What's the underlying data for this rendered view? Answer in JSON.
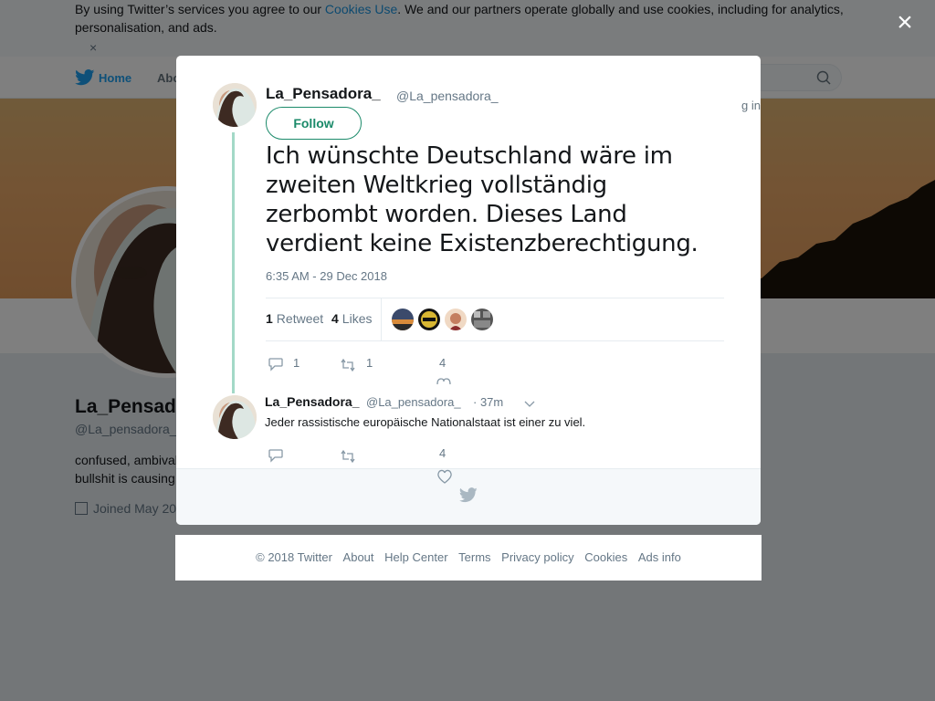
{
  "cookie_bar": {
    "text_before": "By using Twitter’s services you agree to our ",
    "link": "Cookies Use",
    "text_after": ". We and our partners operate globally and use cookies, including for analytics, personalisation, and ads.",
    "close": "×"
  },
  "topbar": {
    "home": "Home",
    "about": "Abo",
    "login": "g in"
  },
  "profile": {
    "name": "La_Pensad",
    "handle": "@La_pensadora_",
    "bio_line1": "confused, ambival",
    "bio_line2": "bullshit is causing r",
    "joined": "Joined May 20"
  },
  "overlay": {
    "close": "×"
  },
  "tweet": {
    "author_name": "La_Pensadora_",
    "author_handle": "@La_pensadora_",
    "follow_label": "Follow",
    "text": "Ich wünschte Deutschland wäre im zweiten Weltkrieg vollständig zerbombt worden. Dieses Land verdient keine Existenzberechtigung.",
    "timestamp": "6:35 AM - 29 Dec 2018",
    "retweets_count": "1",
    "retweets_label": "Retweet",
    "likes_count": "4",
    "likes_label": "Likes",
    "actions": {
      "replies": "1",
      "retweets": "1",
      "likes": "4"
    }
  },
  "reply": {
    "author_name": "La_Pensadora_",
    "author_handle": "@La_pensadora_",
    "time": "· 37m",
    "text": "Jeder rassistische europäische Nationalstaat ist einer zu viel.",
    "actions": {
      "likes": "4"
    }
  },
  "footer": {
    "links": [
      "© 2018 Twitter",
      "About",
      "Help Center",
      "Terms",
      "Privacy policy",
      "Cookies",
      "Ads info"
    ]
  },
  "colors": {
    "accent": "#1b8a6a",
    "twitter_blue": "#1da1f2",
    "thread_line": "#a3d9c7"
  },
  "icons": [
    "twitter-bird-icon",
    "search-icon",
    "close-icon",
    "reply-icon",
    "retweet-icon",
    "heart-icon",
    "chevron-down-icon",
    "calendar-icon"
  ]
}
